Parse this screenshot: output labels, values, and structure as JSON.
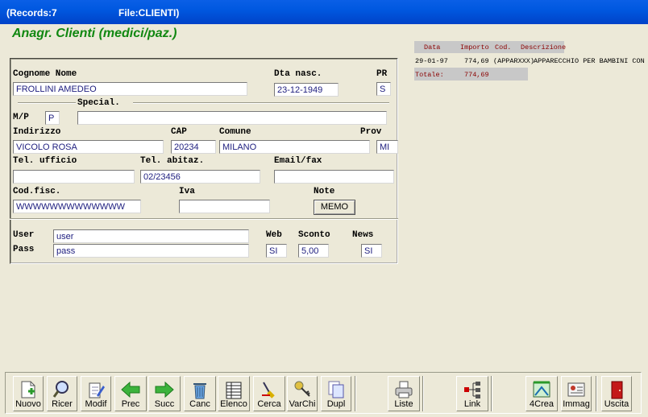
{
  "window": {
    "records": "(Records:7",
    "file": "File:CLIENTI)"
  },
  "form": {
    "heading": "Anagr. Clienti (medici/paz.)",
    "cognome_nome": {
      "label": "Cognome Nome",
      "value": "FROLLINI AMEDEO"
    },
    "dta_nasc": {
      "label": "Dta nasc.",
      "value": "23-12-1949"
    },
    "pr": {
      "label": "PR",
      "value": "S"
    },
    "special": {
      "label": "Special.",
      "value": ""
    },
    "mp": {
      "label": "M/P",
      "value": "P"
    },
    "indirizzo": {
      "label": "Indirizzo",
      "value": "VICOLO ROSA"
    },
    "cap": {
      "label": "CAP",
      "value": "20234"
    },
    "comune": {
      "label": "Comune",
      "value": "MILANO"
    },
    "prov": {
      "label": "Prov",
      "value": "MI"
    },
    "tel_ufficio": {
      "label": "Tel. ufficio",
      "value": ""
    },
    "tel_abitaz": {
      "label": "Tel. abitaz.",
      "value": "02/23456"
    },
    "email_fax": {
      "label": "Email/fax",
      "value": ""
    },
    "cod_fisc": {
      "label": "Cod.fisc.",
      "value": "WWWWWWWWWWWWW"
    },
    "iva": {
      "label": "Iva",
      "value": ""
    },
    "note": {
      "label": "Note",
      "button": "MEMO"
    },
    "user": {
      "label": "User",
      "value": "user"
    },
    "pass": {
      "label": "Pass",
      "value": "pass"
    },
    "web": {
      "label": "Web",
      "value": "SI"
    },
    "sconto": {
      "label": "Sconto",
      "value": "5,00"
    },
    "news": {
      "label": "News",
      "value": "SI"
    }
  },
  "grid": {
    "headers": [
      "Data",
      "Importo",
      "Cod.",
      "Descrizione"
    ],
    "rows": [
      {
        "data": "29-01-97",
        "importo": "774,69",
        "cod": "(APPARXXX)",
        "desc": "APPARECCHIO PER BAMBINI CON"
      }
    ],
    "totale_label": "Totale:",
    "totale_value": "774,69",
    "colors": {
      "header_text": "#8b0000",
      "row_text": "#000000"
    }
  },
  "toolbar": [
    {
      "label": "Nuovo",
      "icon": "new-doc-icon"
    },
    {
      "label": "Ricer",
      "icon": "search-icon"
    },
    {
      "label": "Modif",
      "icon": "edit-icon"
    },
    {
      "label": "Prec",
      "icon": "arrow-left-icon"
    },
    {
      "label": "Succ",
      "icon": "arrow-right-icon"
    },
    {
      "label": "Canc",
      "icon": "trash-icon"
    },
    {
      "label": "Elenco",
      "icon": "list-icon"
    },
    {
      "label": "Cerca",
      "icon": "find-icon"
    },
    {
      "label": "VarChi",
      "icon": "keys-icon"
    },
    {
      "label": "Dupl",
      "icon": "duplicate-icon"
    },
    {
      "label": "Liste",
      "icon": "printer-icon"
    },
    {
      "label": "Link",
      "icon": "link-icon"
    },
    {
      "label": "4Crea",
      "icon": "create-icon"
    },
    {
      "label": "Immag",
      "icon": "image-icon"
    },
    {
      "label": "Uscita",
      "icon": "exit-door-icon"
    }
  ]
}
